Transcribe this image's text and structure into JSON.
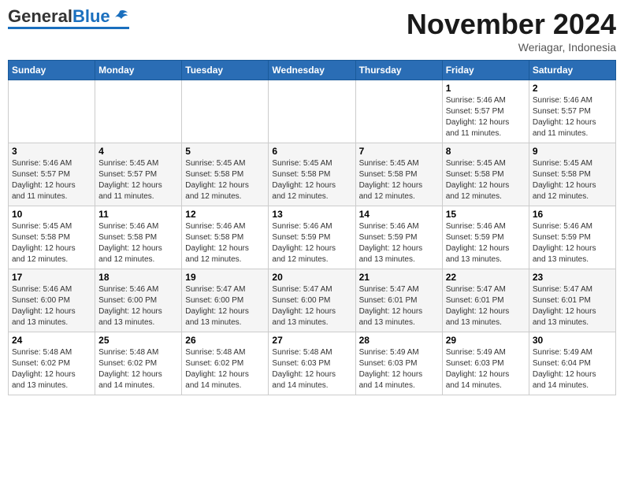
{
  "logo": {
    "general": "General",
    "blue": "Blue"
  },
  "header": {
    "month": "November 2024",
    "location": "Weriagar, Indonesia"
  },
  "weekdays": [
    "Sunday",
    "Monday",
    "Tuesday",
    "Wednesday",
    "Thursday",
    "Friday",
    "Saturday"
  ],
  "weeks": [
    [
      {
        "day": "",
        "info": ""
      },
      {
        "day": "",
        "info": ""
      },
      {
        "day": "",
        "info": ""
      },
      {
        "day": "",
        "info": ""
      },
      {
        "day": "",
        "info": ""
      },
      {
        "day": "1",
        "info": "Sunrise: 5:46 AM\nSunset: 5:57 PM\nDaylight: 12 hours\nand 11 minutes."
      },
      {
        "day": "2",
        "info": "Sunrise: 5:46 AM\nSunset: 5:57 PM\nDaylight: 12 hours\nand 11 minutes."
      }
    ],
    [
      {
        "day": "3",
        "info": "Sunrise: 5:46 AM\nSunset: 5:57 PM\nDaylight: 12 hours\nand 11 minutes."
      },
      {
        "day": "4",
        "info": "Sunrise: 5:45 AM\nSunset: 5:57 PM\nDaylight: 12 hours\nand 11 minutes."
      },
      {
        "day": "5",
        "info": "Sunrise: 5:45 AM\nSunset: 5:58 PM\nDaylight: 12 hours\nand 12 minutes."
      },
      {
        "day": "6",
        "info": "Sunrise: 5:45 AM\nSunset: 5:58 PM\nDaylight: 12 hours\nand 12 minutes."
      },
      {
        "day": "7",
        "info": "Sunrise: 5:45 AM\nSunset: 5:58 PM\nDaylight: 12 hours\nand 12 minutes."
      },
      {
        "day": "8",
        "info": "Sunrise: 5:45 AM\nSunset: 5:58 PM\nDaylight: 12 hours\nand 12 minutes."
      },
      {
        "day": "9",
        "info": "Sunrise: 5:45 AM\nSunset: 5:58 PM\nDaylight: 12 hours\nand 12 minutes."
      }
    ],
    [
      {
        "day": "10",
        "info": "Sunrise: 5:45 AM\nSunset: 5:58 PM\nDaylight: 12 hours\nand 12 minutes."
      },
      {
        "day": "11",
        "info": "Sunrise: 5:46 AM\nSunset: 5:58 PM\nDaylight: 12 hours\nand 12 minutes."
      },
      {
        "day": "12",
        "info": "Sunrise: 5:46 AM\nSunset: 5:58 PM\nDaylight: 12 hours\nand 12 minutes."
      },
      {
        "day": "13",
        "info": "Sunrise: 5:46 AM\nSunset: 5:59 PM\nDaylight: 12 hours\nand 12 minutes."
      },
      {
        "day": "14",
        "info": "Sunrise: 5:46 AM\nSunset: 5:59 PM\nDaylight: 12 hours\nand 13 minutes."
      },
      {
        "day": "15",
        "info": "Sunrise: 5:46 AM\nSunset: 5:59 PM\nDaylight: 12 hours\nand 13 minutes."
      },
      {
        "day": "16",
        "info": "Sunrise: 5:46 AM\nSunset: 5:59 PM\nDaylight: 12 hours\nand 13 minutes."
      }
    ],
    [
      {
        "day": "17",
        "info": "Sunrise: 5:46 AM\nSunset: 6:00 PM\nDaylight: 12 hours\nand 13 minutes."
      },
      {
        "day": "18",
        "info": "Sunrise: 5:46 AM\nSunset: 6:00 PM\nDaylight: 12 hours\nand 13 minutes."
      },
      {
        "day": "19",
        "info": "Sunrise: 5:47 AM\nSunset: 6:00 PM\nDaylight: 12 hours\nand 13 minutes."
      },
      {
        "day": "20",
        "info": "Sunrise: 5:47 AM\nSunset: 6:00 PM\nDaylight: 12 hours\nand 13 minutes."
      },
      {
        "day": "21",
        "info": "Sunrise: 5:47 AM\nSunset: 6:01 PM\nDaylight: 12 hours\nand 13 minutes."
      },
      {
        "day": "22",
        "info": "Sunrise: 5:47 AM\nSunset: 6:01 PM\nDaylight: 12 hours\nand 13 minutes."
      },
      {
        "day": "23",
        "info": "Sunrise: 5:47 AM\nSunset: 6:01 PM\nDaylight: 12 hours\nand 13 minutes."
      }
    ],
    [
      {
        "day": "24",
        "info": "Sunrise: 5:48 AM\nSunset: 6:02 PM\nDaylight: 12 hours\nand 13 minutes."
      },
      {
        "day": "25",
        "info": "Sunrise: 5:48 AM\nSunset: 6:02 PM\nDaylight: 12 hours\nand 14 minutes."
      },
      {
        "day": "26",
        "info": "Sunrise: 5:48 AM\nSunset: 6:02 PM\nDaylight: 12 hours\nand 14 minutes."
      },
      {
        "day": "27",
        "info": "Sunrise: 5:48 AM\nSunset: 6:03 PM\nDaylight: 12 hours\nand 14 minutes."
      },
      {
        "day": "28",
        "info": "Sunrise: 5:49 AM\nSunset: 6:03 PM\nDaylight: 12 hours\nand 14 minutes."
      },
      {
        "day": "29",
        "info": "Sunrise: 5:49 AM\nSunset: 6:03 PM\nDaylight: 12 hours\nand 14 minutes."
      },
      {
        "day": "30",
        "info": "Sunrise: 5:49 AM\nSunset: 6:04 PM\nDaylight: 12 hours\nand 14 minutes."
      }
    ]
  ]
}
